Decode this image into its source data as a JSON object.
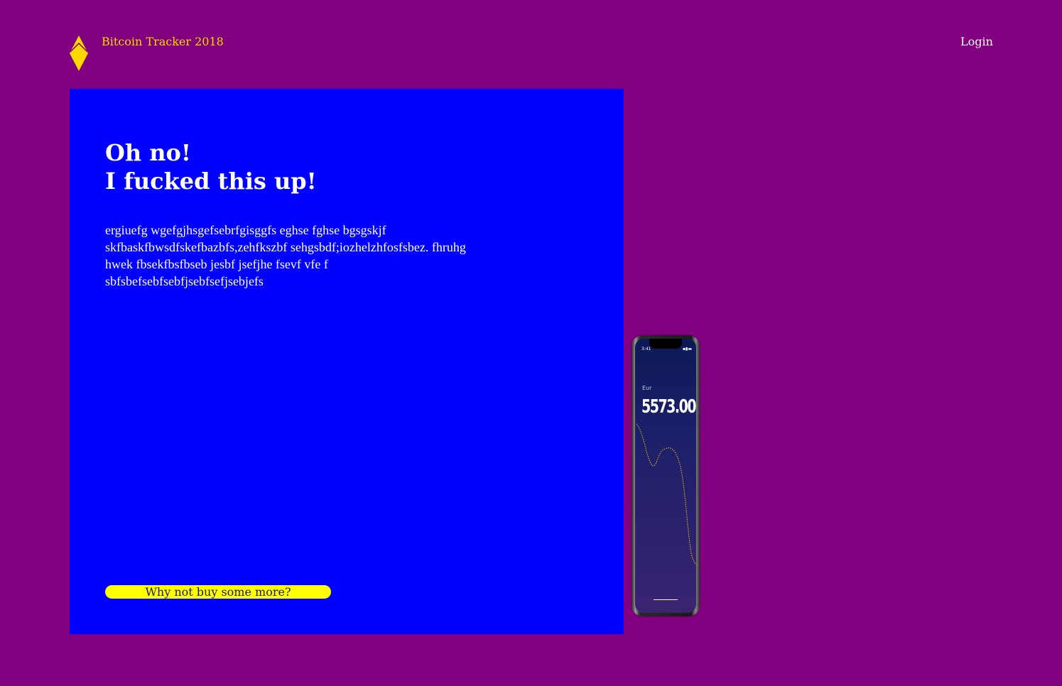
{
  "header": {
    "brand": "Bitcoin Tracker 2018",
    "login_label": "Login",
    "logo_icon": "diamond-logo-icon"
  },
  "hero": {
    "title_line1": "Oh no!",
    "title_line2": "I fucked this up!",
    "body": "ergiuefg wgefgjhsgefsebrfgisggfs eghse fghse bgsgskjf skfbaskfbwsdfskefbazbfs,zehfkszbf sehgsbdf;iozhelzhfosfsbez. fhruhg hwek fbsekfbsfbseb jesbf jsefjhe fsevf vfe f sbfsbefsebfsebfjsebfsefjsebjefs",
    "cta_label": "Why not buy some more?"
  },
  "phone": {
    "status_time": "3:41",
    "status_icons": "▪▮▬",
    "currency_label": "Eur",
    "price": "5573.00",
    "chart_icon": "price-sparkline"
  },
  "colors": {
    "background": "#800080",
    "hero_background": "#0000ff",
    "brand_text": "#ffd800",
    "cta_background": "#ffff00",
    "sparkline": "#f2c200"
  }
}
